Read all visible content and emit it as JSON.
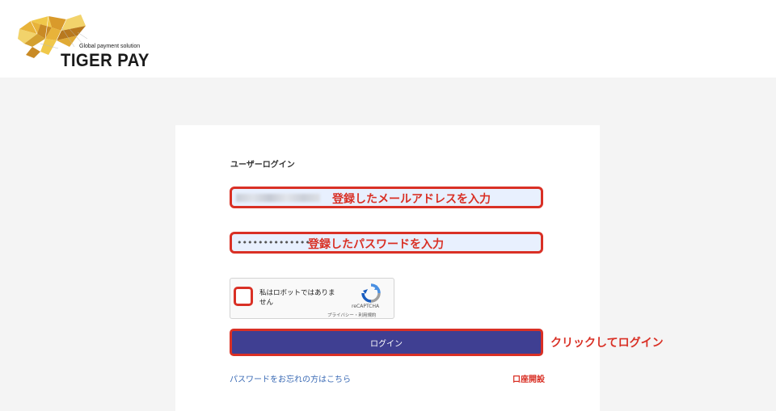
{
  "header": {
    "logo": {
      "tagline": "Global payment solution",
      "name": "TIGER PAY",
      "icon": "tiger-logo-icon"
    }
  },
  "login": {
    "title": "ユーザーログイン",
    "email": {
      "value": "",
      "annotation": "登録したメールアドレスを入力"
    },
    "password": {
      "value": "••••••••••••••",
      "annotation": "登録したパスワードを入力"
    },
    "captcha": {
      "label": "私はロボットではありません",
      "brand": "reCAPTCHA",
      "links": "プライバシー・利用規約",
      "icon": "recaptcha-icon"
    },
    "submit_label": "ログイン",
    "submit_annotation": "クリックしてログイン",
    "forgot_password": "パスワードをお忘れの方はこちら",
    "open_account": "口座開設"
  },
  "colors": {
    "accent": "#3f3f92",
    "annotation_red": "#d93025",
    "link_blue": "#3b6bb5",
    "field_bg": "#e8f0fe"
  }
}
